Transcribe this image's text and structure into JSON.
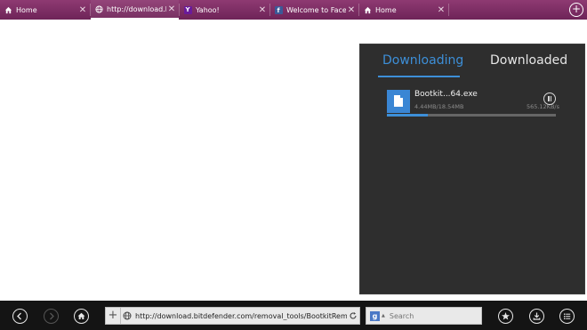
{
  "tabs": [
    {
      "title": "Home",
      "icon": "home-icon"
    },
    {
      "title": "http://download.bitde",
      "icon": "globe-icon"
    },
    {
      "title": "Yahoo!",
      "icon": "yahoo-icon",
      "favicon_text": "Y"
    },
    {
      "title": "Welcome to Facebook",
      "icon": "facebook-icon",
      "favicon_text": "f"
    },
    {
      "title": "Home",
      "icon": "home-icon"
    }
  ],
  "active_tab_index": 1,
  "downloads": {
    "tab_downloading": "Downloading",
    "tab_downloaded": "Downloaded",
    "item": {
      "name": "Bootkit...64.exe",
      "size": "4.44MB/18.54MB",
      "speed": "565.12KB/s",
      "progress": 0.24
    }
  },
  "toolbar": {
    "url": "http://download.bitdefender.com/removal_tools/BootkitRemov",
    "search_placeholder": "Search",
    "search_engine_letter": "g"
  },
  "colors": {
    "tabbar": "#7d2f66",
    "accent": "#3d8fd8",
    "panel": "#2e2e2e",
    "bottombar": "#141414"
  }
}
